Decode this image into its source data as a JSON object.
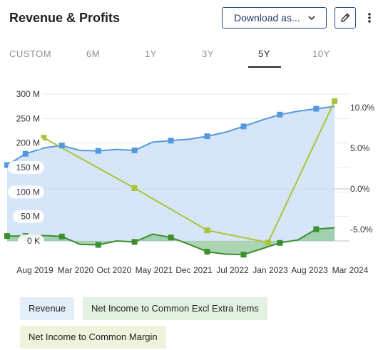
{
  "header": {
    "title": "Revenue & Profits",
    "download_label": "Download as...",
    "edit_icon": "pencil-icon",
    "more_icon": "vertical-dots-icon"
  },
  "tabs": [
    {
      "label": "CUSTOM",
      "active": false
    },
    {
      "label": "6M",
      "active": false
    },
    {
      "label": "1Y",
      "active": false
    },
    {
      "label": "3Y",
      "active": false
    },
    {
      "label": "5Y",
      "active": true
    },
    {
      "label": "10Y",
      "active": false
    }
  ],
  "legend": {
    "revenue": "Revenue",
    "net_income": "Net Income to Common Excl Extra Items",
    "margin": "Net Income to Common Margin"
  },
  "colors": {
    "revenue_line": "#5599dd",
    "revenue_fill": "#cfe0f6",
    "net_income_line": "#3a8f2e",
    "net_income_fill": "#8fc79a",
    "margin_line": "#a8c53a",
    "revenue_chip_bg": "#e4eef9",
    "net_income_chip_bg": "#e3f1e3",
    "margin_chip_bg": "#eef3dc",
    "accent": "#1f4e8c"
  },
  "chart_data": {
    "type": "area",
    "x_ticks": [
      "Aug 2019",
      "Mar 2020",
      "Oct 2020",
      "May 2021",
      "Dec 2021",
      "Jul 2022",
      "Jan 2023",
      "Aug 2023",
      "Mar 2024"
    ],
    "y_left_ticks": [
      "300 M",
      "250 M",
      "200 M",
      "150 M",
      "100 M",
      "50 M",
      "0 K"
    ],
    "y_left_range": [
      0,
      300000000
    ],
    "y_right_ticks": [
      "10.0%",
      "5.0%",
      "0.0%",
      "-5.0%"
    ],
    "y_right_range": [
      -6.4,
      11.6
    ],
    "grid": true,
    "series": [
      {
        "name": "Revenue",
        "axis": "left",
        "type": "area",
        "points": [
          {
            "x": "2019-06-30",
            "y": 155000000,
            "marker": true
          },
          {
            "x": "2019-09-30",
            "y": 178000000,
            "marker": true
          },
          {
            "x": "2019-12-31",
            "y": 190000000,
            "marker": false
          },
          {
            "x": "2020-03-31",
            "y": 195000000,
            "marker": true
          },
          {
            "x": "2020-06-30",
            "y": 185000000,
            "marker": false
          },
          {
            "x": "2020-09-30",
            "y": 184000000,
            "marker": true
          },
          {
            "x": "2020-12-31",
            "y": 187000000,
            "marker": false
          },
          {
            "x": "2021-03-31",
            "y": 185000000,
            "marker": true
          },
          {
            "x": "2021-06-30",
            "y": 202000000,
            "marker": false
          },
          {
            "x": "2021-09-30",
            "y": 205000000,
            "marker": true
          },
          {
            "x": "2021-12-31",
            "y": 208000000,
            "marker": false
          },
          {
            "x": "2022-03-31",
            "y": 214000000,
            "marker": true
          },
          {
            "x": "2022-06-30",
            "y": 222000000,
            "marker": false
          },
          {
            "x": "2022-09-30",
            "y": 234000000,
            "marker": true
          },
          {
            "x": "2022-12-31",
            "y": 247000000,
            "marker": false
          },
          {
            "x": "2023-03-31",
            "y": 258000000,
            "marker": true
          },
          {
            "x": "2023-06-30",
            "y": 265000000,
            "marker": false
          },
          {
            "x": "2023-09-30",
            "y": 270000000,
            "marker": true
          },
          {
            "x": "2023-12-31",
            "y": 275000000,
            "marker": false
          }
        ]
      },
      {
        "name": "Net Income to Common Excl Extra Items",
        "axis": "left",
        "type": "area",
        "points": [
          {
            "x": "2019-06-30",
            "y": 10000000,
            "marker": true
          },
          {
            "x": "2019-09-30",
            "y": 10000000,
            "marker": true
          },
          {
            "x": "2019-12-31",
            "y": 11000000,
            "marker": false
          },
          {
            "x": "2020-03-31",
            "y": 9000000,
            "marker": true
          },
          {
            "x": "2020-06-30",
            "y": -7000000,
            "marker": false
          },
          {
            "x": "2020-09-30",
            "y": -8000000,
            "marker": true
          },
          {
            "x": "2020-12-31",
            "y": 0,
            "marker": false
          },
          {
            "x": "2021-03-31",
            "y": -2000000,
            "marker": true
          },
          {
            "x": "2021-06-30",
            "y": 14000000,
            "marker": false
          },
          {
            "x": "2021-09-30",
            "y": 7000000,
            "marker": true
          },
          {
            "x": "2021-12-31",
            "y": -7000000,
            "marker": false
          },
          {
            "x": "2022-03-31",
            "y": -22000000,
            "marker": true
          },
          {
            "x": "2022-06-30",
            "y": -27000000,
            "marker": false
          },
          {
            "x": "2022-09-30",
            "y": -28000000,
            "marker": true
          },
          {
            "x": "2022-12-31",
            "y": -16000000,
            "marker": false
          },
          {
            "x": "2023-03-31",
            "y": -4000000,
            "marker": true
          },
          {
            "x": "2023-06-30",
            "y": 2000000,
            "marker": false
          },
          {
            "x": "2023-09-30",
            "y": 24000000,
            "marker": true
          },
          {
            "x": "2023-12-31",
            "y": 27000000,
            "marker": false
          }
        ]
      },
      {
        "name": "Net Income to Common Margin",
        "axis": "right",
        "type": "line",
        "points": [
          {
            "x": "2019-12-31",
            "y": 6.3
          },
          {
            "x": "2021-03-31",
            "y": 0.1
          },
          {
            "x": "2022-03-31",
            "y": -5.1
          },
          {
            "x": "2023-01-31",
            "y": -6.6
          },
          {
            "x": "2023-12-31",
            "y": 10.8
          }
        ]
      }
    ]
  }
}
